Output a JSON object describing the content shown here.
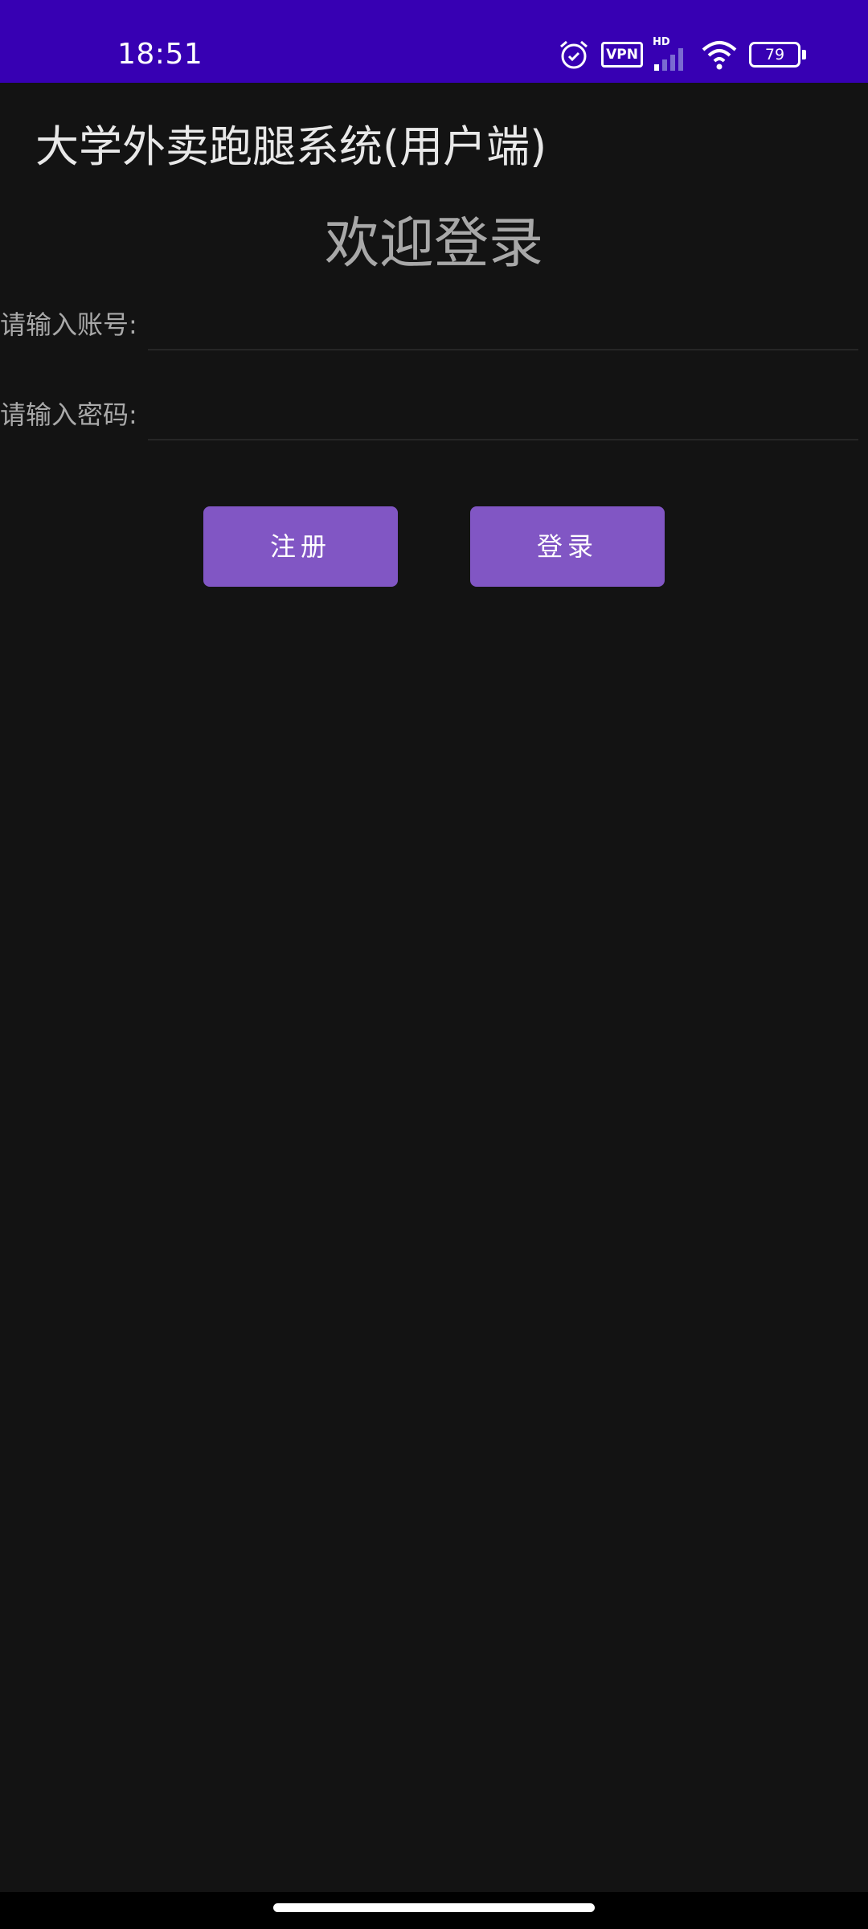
{
  "status_bar": {
    "time": "18:51",
    "vpn_label": "VPN",
    "network_label": "HD",
    "battery_level": "79",
    "icons": [
      "alarm-icon",
      "vpn-icon",
      "signal-icon",
      "wifi-icon",
      "battery-icon"
    ]
  },
  "app": {
    "title": "大学外卖跑腿系统(用户端)",
    "welcome": "欢迎登录"
  },
  "form": {
    "account_label": "请输入账号:",
    "account_value": "",
    "password_label": "请输入密码:",
    "password_value": ""
  },
  "buttons": {
    "register": "注册",
    "login": "登录"
  },
  "colors": {
    "status_bar": "#3700b3",
    "background": "#131313",
    "button": "#8156c4"
  }
}
